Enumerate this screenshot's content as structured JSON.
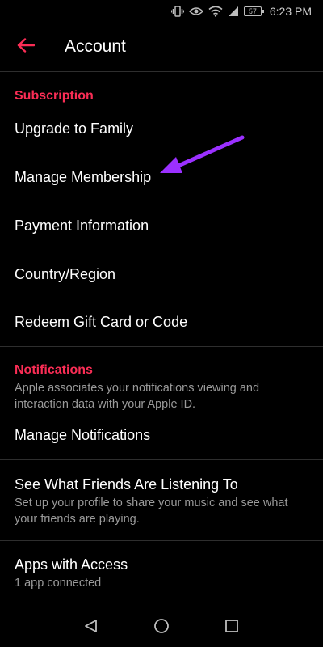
{
  "status_bar": {
    "battery_level": "57",
    "time": "6:23 PM"
  },
  "header": {
    "title": "Account",
    "back_icon": "back-arrow-icon"
  },
  "subscription": {
    "header": "Subscription",
    "items": [
      {
        "label": "Upgrade to Family"
      },
      {
        "label": "Manage Membership"
      },
      {
        "label": "Payment Information"
      },
      {
        "label": "Country/Region"
      },
      {
        "label": "Redeem Gift Card or Code"
      }
    ]
  },
  "notifications": {
    "header": "Notifications",
    "description": "Apple associates your notifications viewing and interaction data with your Apple ID.",
    "manage_label": "Manage Notifications"
  },
  "friends": {
    "title": "See What Friends Are Listening To",
    "description": "Set up your profile to share your music and see what your friends are playing."
  },
  "apps": {
    "title": "Apps with Access",
    "subtitle": "1 app connected"
  },
  "colors": {
    "accent": "#fa2d55",
    "annotation": "#9b30ff",
    "background": "#000000"
  }
}
